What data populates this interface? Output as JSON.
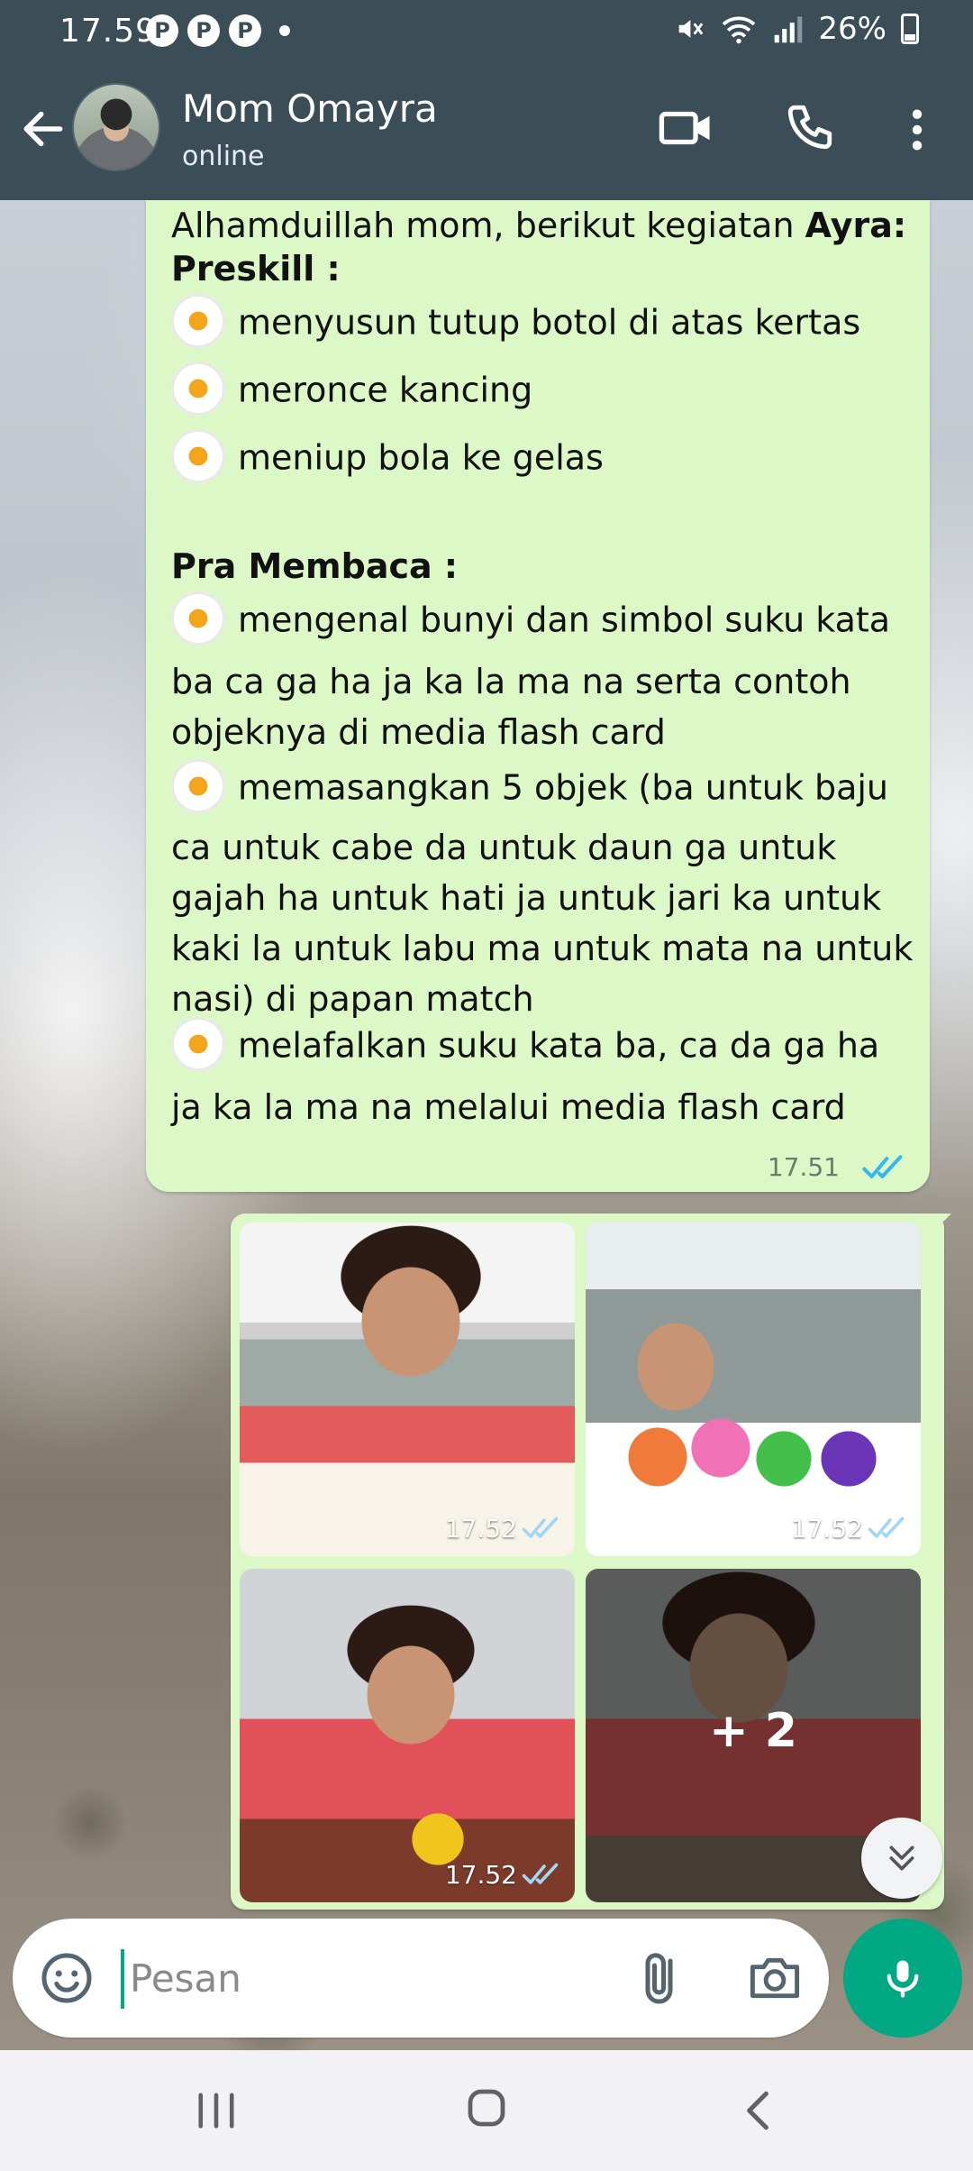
{
  "status_bar": {
    "time": "17.59",
    "pinterest_badge": "P",
    "battery": "26%"
  },
  "header": {
    "contact_name": "Mom Omayra",
    "contact_status": "online"
  },
  "message": {
    "greeting": "Alhamduillah mom, berikut kegiatan",
    "child_name": "Ayra:",
    "section1": "Preskill :",
    "preskill_items": [
      "menyusun tutup botol di atas kertas",
      "meronce kancing",
      "meniup bola ke gelas"
    ],
    "section2": "Pra Membaca :",
    "item4": [
      "mengenal bunyi dan simbol suku kata",
      "ba ca ga ha ja ka la ma na serta contoh",
      "objeknya di media flash card"
    ],
    "item5": [
      "memasangkan 5 objek (ba untuk baju",
      "ca untuk cabe da untuk daun ga untuk",
      "gajah ha untuk hati ja untuk jari ka untuk",
      "kaki la untuk labu ma untuk mata na untuk",
      "nasi) di papan match"
    ],
    "item6": [
      "melafalkan suku kata ba, ca da ga ha",
      "ja ka la ma na melalui media flash card"
    ],
    "time": "17.51"
  },
  "photos": {
    "times": [
      "17.52",
      "17.52",
      "17.52"
    ],
    "more_count": "+ 2"
  },
  "composer": {
    "placeholder": "Pesan"
  },
  "colors": {
    "header": "#3b4d57",
    "bubble": "#dcf8c6",
    "accent": "#00a884",
    "read_ticks": "#34b7f1"
  },
  "icons": [
    "back-icon",
    "video-icon",
    "call-icon",
    "menu-icon",
    "flower-icon",
    "double-check-icon",
    "chevron-double-down-icon",
    "emoji-icon",
    "attach-icon",
    "camera-icon",
    "mic-icon"
  ]
}
